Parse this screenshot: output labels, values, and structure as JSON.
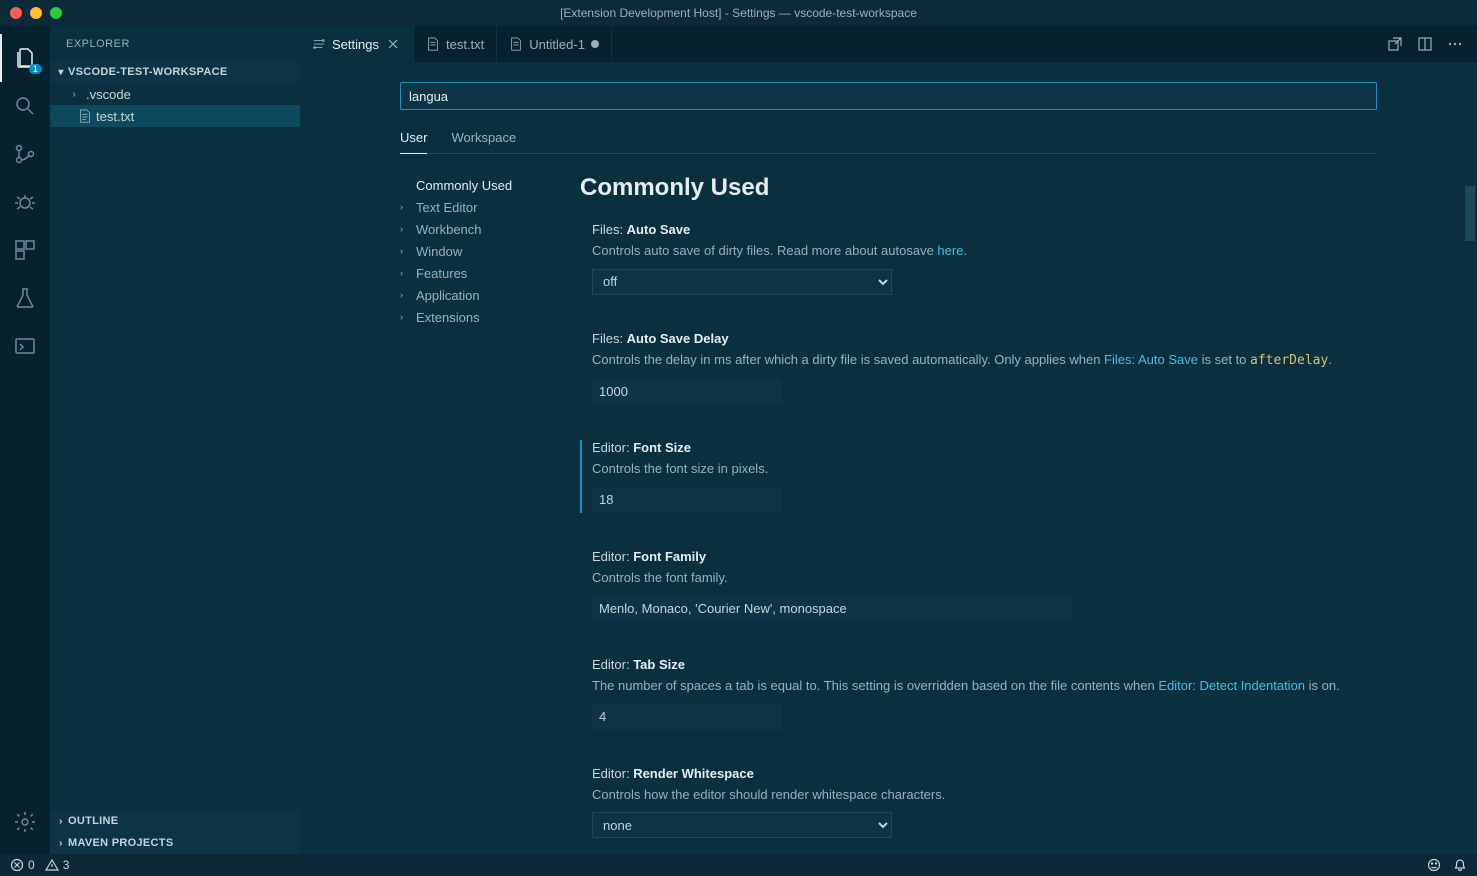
{
  "window": {
    "title": "[Extension Development Host] - Settings — vscode-test-workspace"
  },
  "activity": {
    "explorer_badge": "1"
  },
  "sidebar": {
    "header": "EXPLORER",
    "workspace": "VSCODE-TEST-WORKSPACE",
    "items": [
      {
        "label": ".vscode",
        "type": "folder"
      },
      {
        "label": "test.txt",
        "type": "file",
        "selected": true
      }
    ],
    "outline": "OUTLINE",
    "maven": "MAVEN PROJECTS"
  },
  "tabs": [
    {
      "label": "Settings",
      "active": true,
      "closeable": true,
      "kind": "settings"
    },
    {
      "label": "test.txt",
      "active": false,
      "closeable": false,
      "kind": "file"
    },
    {
      "label": "Untitled-1",
      "active": false,
      "dirty": true,
      "kind": "file"
    }
  ],
  "settings": {
    "search_value": "langua",
    "scopes": {
      "user": "User",
      "workspace": "Workspace"
    },
    "toc": [
      "Commonly Used",
      "Text Editor",
      "Workbench",
      "Window",
      "Features",
      "Application",
      "Extensions"
    ],
    "section_title": "Commonly Used",
    "items": {
      "autosave": {
        "ns": "Files: ",
        "name": "Auto Save",
        "desc_pre": "Controls auto save of dirty files. Read more about autosave ",
        "link": "here",
        "desc_post": ".",
        "value": "off"
      },
      "autosave_delay": {
        "ns": "Files: ",
        "name": "Auto Save Delay",
        "desc_pre": "Controls the delay in ms after which a dirty file is saved automatically. Only applies when ",
        "link": "Files: Auto Save",
        "desc_mid": " is set to ",
        "code": "afterDelay",
        "desc_post": ".",
        "value": "1000"
      },
      "font_size": {
        "ns": "Editor: ",
        "name": "Font Size",
        "desc": "Controls the font size in pixels.",
        "value": "18"
      },
      "font_family": {
        "ns": "Editor: ",
        "name": "Font Family",
        "desc": "Controls the font family.",
        "value": "Menlo, Monaco, 'Courier New', monospace"
      },
      "tab_size": {
        "ns": "Editor: ",
        "name": "Tab Size",
        "desc_pre": "The number of spaces a tab is equal to. This setting is overridden based on the file contents when ",
        "link": "Editor: Detect Indentation",
        "desc_post": " is on.",
        "value": "4"
      },
      "render_ws": {
        "ns": "Editor: ",
        "name": "Render Whitespace",
        "desc": "Controls how the editor should render whitespace characters.",
        "value": "none"
      }
    }
  },
  "statusbar": {
    "errors": "0",
    "warnings": "3"
  }
}
